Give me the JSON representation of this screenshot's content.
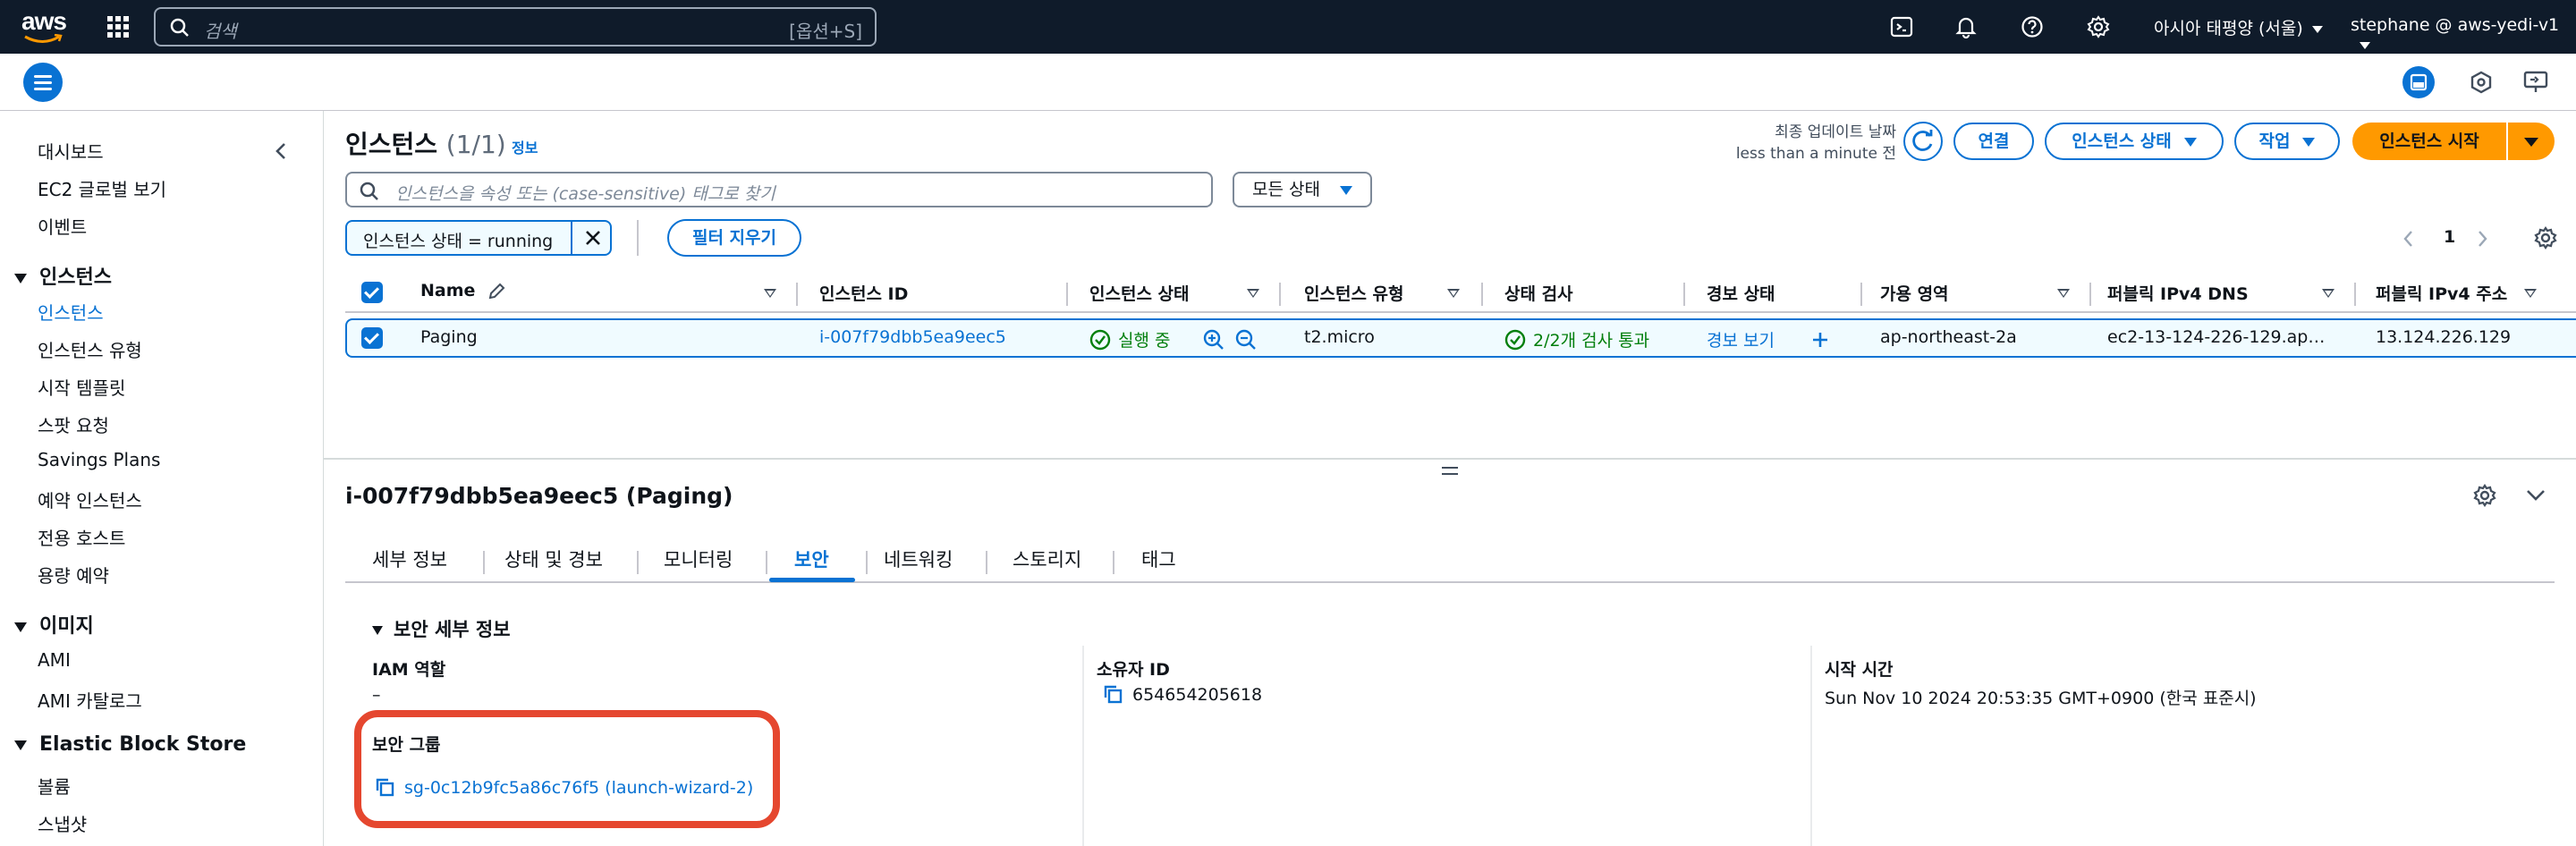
{
  "topnav": {
    "logo": "aws",
    "search_placeholder": "검색",
    "search_shortcut": "[옵션+S]",
    "region": "아시아 태평양 (서울)",
    "user": "stephane @ aws-yedi-v1"
  },
  "sidebar": {
    "items_top": [
      "대시보드",
      "EC2 글로벌 보기",
      "이벤트"
    ],
    "sections": [
      {
        "title": "인스턴스",
        "items": [
          "인스턴스",
          "인스턴스 유형",
          "시작 템플릿",
          "스팟 요청",
          "Savings Plans",
          "예약 인스턴스",
          "전용 호스트",
          "용량 예약"
        ]
      },
      {
        "title": "이미지",
        "items": [
          "AMI",
          "AMI 카탈로그"
        ]
      },
      {
        "title": "Elastic Block Store",
        "items": [
          "볼륨",
          "스냅샷"
        ]
      }
    ]
  },
  "header": {
    "title": "인스턴스",
    "count": "(1/1)",
    "info": "정보",
    "last_update_label": "최종 업데이트 날짜",
    "last_update_value": "less than a minute 전",
    "btn_connect": "연결",
    "btn_state": "인스턴스 상태",
    "btn_actions": "작업",
    "btn_launch": "인스턴스 시작"
  },
  "filter": {
    "placeholder": "인스턴스을 속성 또는 (case-sensitive) 태그로 찾기",
    "status_select": "모든 상태",
    "token": "인스턴스 상태 = running",
    "clear": "필터 지우기",
    "page": "1"
  },
  "table": {
    "headers": [
      "Name",
      "인스턴스 ID",
      "인스턴스 상태",
      "인스턴스 유형",
      "상태 검사",
      "경보 상태",
      "가용 영역",
      "퍼블릭 IPv4 DNS",
      "퍼블릭 IPv4 주소"
    ],
    "row": {
      "name": "Paging",
      "id": "i-007f79dbb5ea9eec5",
      "state": "실행 중",
      "type": "t2.micro",
      "check": "2/2개 검사 통과",
      "alarm": "경보 보기",
      "az": "ap-northeast-2a",
      "dns": "ec2-13-124-226-129.ap…",
      "ip": "13.124.226.129"
    }
  },
  "panel": {
    "title": "i-007f79dbb5ea9eec5 (Paging)",
    "tabs": [
      "세부 정보",
      "상태 및 경보",
      "모니터링",
      "보안",
      "네트워킹",
      "스토리지",
      "태그"
    ],
    "active_tab": "보안",
    "section": "보안 세부 정보",
    "iam_label": "IAM 역할",
    "iam_value": "–",
    "owner_label": "소유자 ID",
    "owner_value": "654654205618",
    "launch_label": "시작 시간",
    "launch_value": "Sun Nov 10 2024 20:53:35 GMT+0900 (한국 표준시)",
    "sg_label": "보안 그룹",
    "sg_value": "sg-0c12b9fc5a86c76f5 (launch-wizard-2)"
  },
  "colors": {
    "nav_bg": "#0f1b2a",
    "accent": "#0972d3",
    "primary": "#ff9900",
    "success": "#037f0c",
    "highlight": "#e5472f"
  }
}
